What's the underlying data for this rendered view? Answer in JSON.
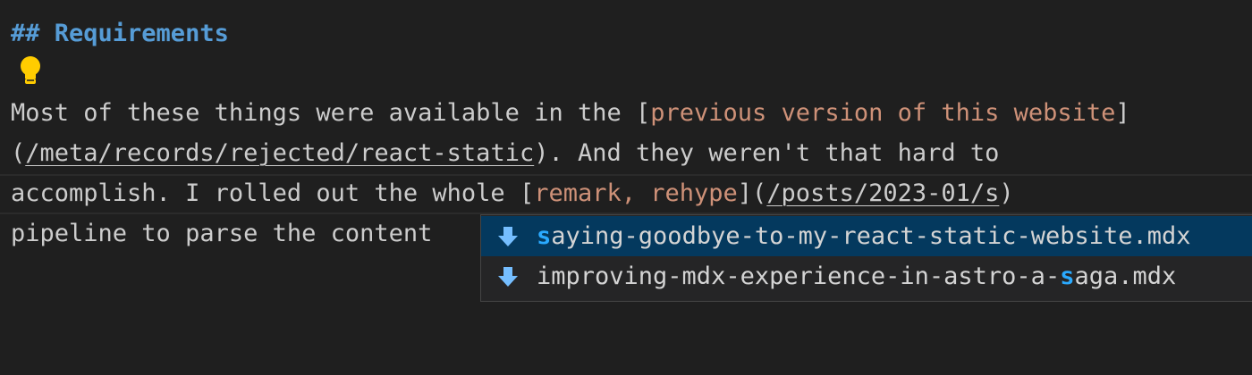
{
  "editor": {
    "heading": "## Requirements",
    "line1_text": "Most of these things were available in the [",
    "line1_link_text": "previous version of this website",
    "line1_close": "]",
    "line2_open": "(",
    "line2_url": "/meta/records/rejected/react-static",
    "line2_rest": "). And they weren't that hard to",
    "line3_text": "accomplish. I rolled out the whole [",
    "line3_link_text": "remark, rehype",
    "line3_mid": "](",
    "line3_url": "/posts/2023-01/s",
    "line3_close": ")",
    "line4_text": "pipeline to parse the content",
    "lightbulb_icon": "lightbulb-icon"
  },
  "suggestions": {
    "items": [
      {
        "highlight": "s",
        "label_rest": "aying-goodbye-to-my-react-static-website.mdx",
        "icon": "file-arrow-down-icon",
        "selected": true
      },
      {
        "label_before": "improving-mdx-experience-in-astro-a-",
        "highlight": "s",
        "label_rest": "aga.mdx",
        "icon": "file-arrow-down-icon",
        "selected": false
      }
    ]
  },
  "colors": {
    "background": "#1f1f1f",
    "heading": "#569cd6",
    "link_text": "#ce9178",
    "selection": "#04395e",
    "match_highlight": "#2aaaff",
    "icon": "#75beff"
  }
}
